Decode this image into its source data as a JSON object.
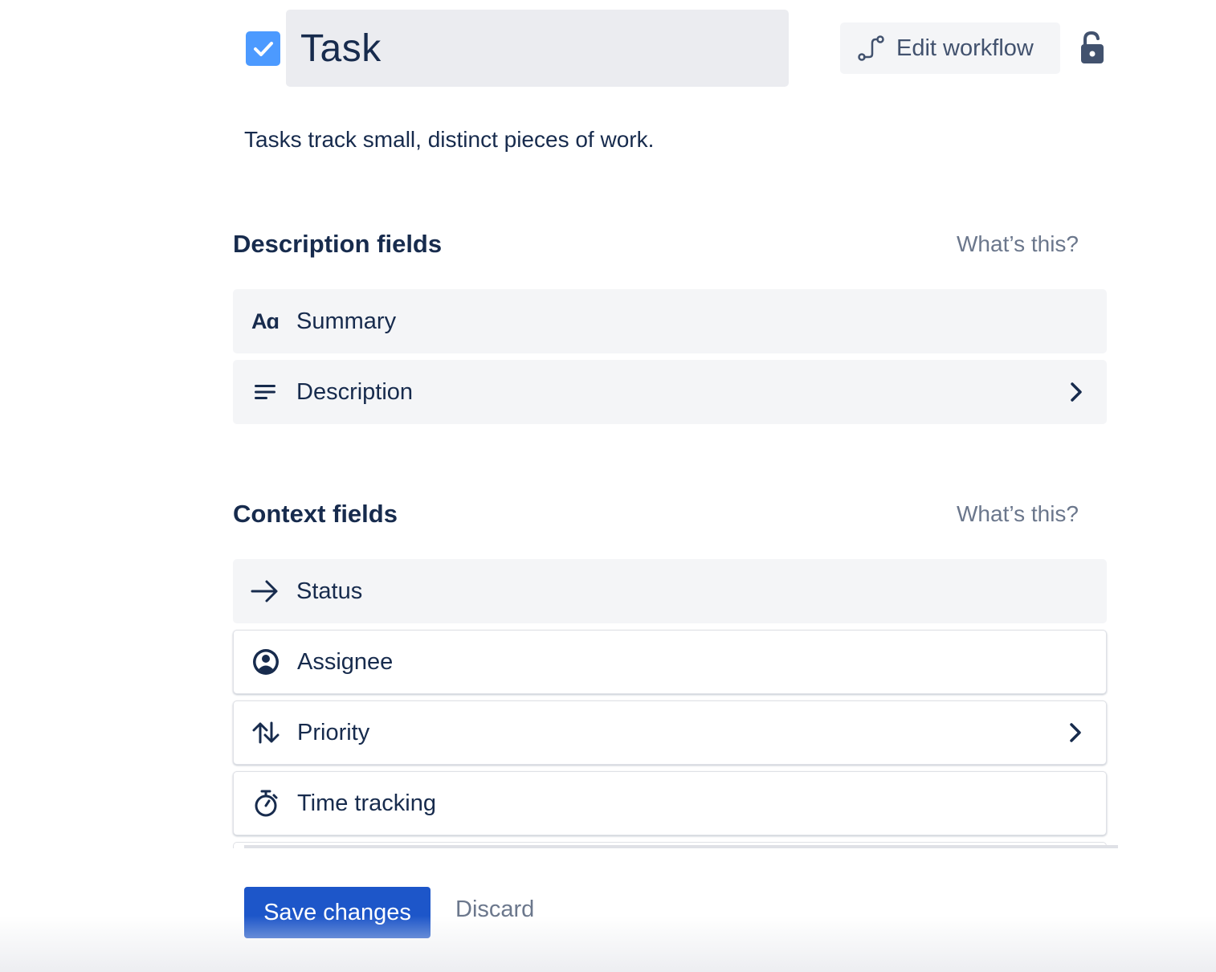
{
  "header": {
    "title": "Task",
    "edit_workflow_label": "Edit workflow",
    "subtitle": "Tasks track small, distinct pieces of work."
  },
  "description_section": {
    "heading": "Description fields",
    "help_link": "What’s this?",
    "fields": [
      {
        "label": "Summary",
        "icon": "text-format-icon",
        "has_chevron": false
      },
      {
        "label": "Description",
        "icon": "text-lines-icon",
        "has_chevron": true
      }
    ]
  },
  "context_section": {
    "heading": "Context fields",
    "help_link": "What’s this?",
    "fields": [
      {
        "label": "Status",
        "icon": "arrow-right-icon",
        "has_chevron": false
      },
      {
        "label": "Assignee",
        "icon": "user-avatar-icon",
        "has_chevron": false
      },
      {
        "label": "Priority",
        "icon": "sort-arrows-icon",
        "has_chevron": true
      },
      {
        "label": "Time tracking",
        "icon": "stopwatch-icon",
        "has_chevron": false
      }
    ]
  },
  "footer": {
    "save_label": "Save changes",
    "discard_label": "Discard"
  },
  "colors": {
    "primary": "#1d56c9",
    "checkbox": "#4c9aff",
    "text": "#172b4d",
    "subtle": "#6b778c"
  }
}
